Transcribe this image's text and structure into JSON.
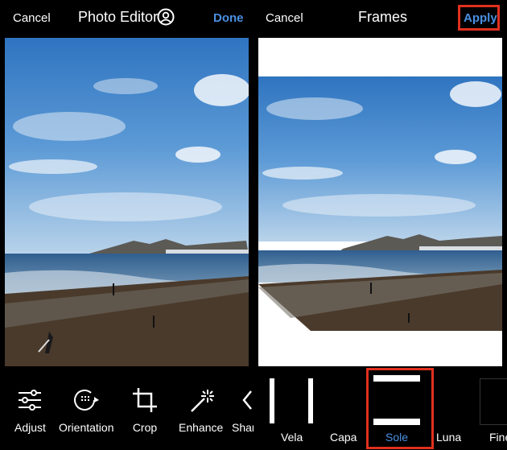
{
  "left_panel": {
    "cancel_label": "Cancel",
    "title": "Photo Editor",
    "done_label": "Done",
    "tools": [
      {
        "label": "Adjust"
      },
      {
        "label": "Orientation"
      },
      {
        "label": "Crop"
      },
      {
        "label": "Enhance"
      },
      {
        "label": "Shar"
      }
    ]
  },
  "right_panel": {
    "cancel_label": "Cancel",
    "title": "Frames",
    "apply_label": "Apply",
    "frames": [
      {
        "label": "Vela"
      },
      {
        "label": "Capa"
      },
      {
        "label": "Sole",
        "selected": true
      },
      {
        "label": "Luna"
      },
      {
        "label": "Fine"
      }
    ]
  },
  "colors": {
    "accent": "#4a90e2",
    "highlight": "#e0301e",
    "background": "#000000"
  }
}
